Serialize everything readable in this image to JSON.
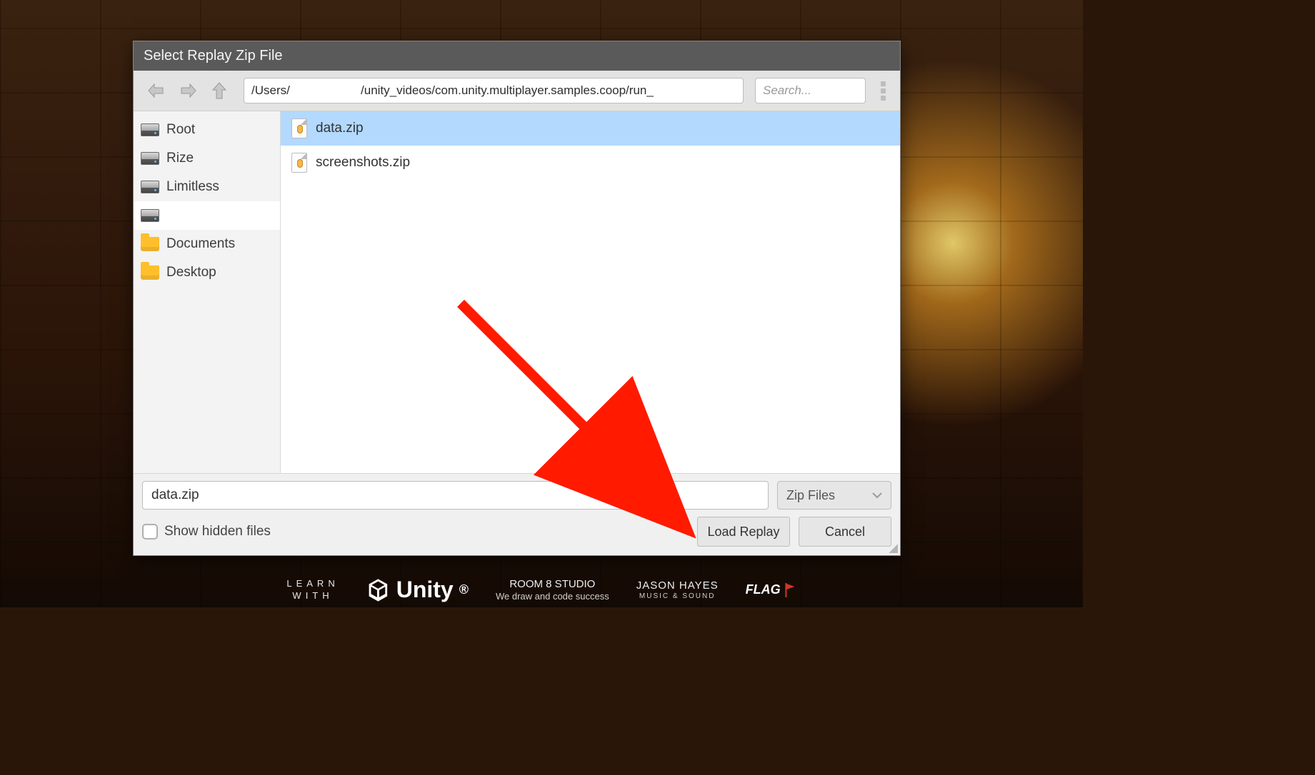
{
  "dialog": {
    "title": "Select Replay Zip File",
    "path_value": "/Users/                     /unity_videos/com.unity.multiplayer.samples.coop/run_",
    "search_placeholder": "Search...",
    "sidebar": [
      {
        "icon": "drive",
        "label": "Root",
        "selected": false
      },
      {
        "icon": "drive",
        "label": "Rize",
        "selected": false
      },
      {
        "icon": "drive",
        "label": "Limitless",
        "selected": false
      },
      {
        "icon": "drive",
        "label": "",
        "selected": true
      },
      {
        "icon": "folder",
        "label": "Documents",
        "selected": false
      },
      {
        "icon": "folder",
        "label": "Desktop",
        "selected": false
      }
    ],
    "files": [
      {
        "name": "data.zip",
        "selected": true
      },
      {
        "name": "screenshots.zip",
        "selected": false
      }
    ],
    "filename_value": "data.zip",
    "type_label": "Zip Files",
    "show_hidden_label": "Show hidden files",
    "show_hidden_checked": false,
    "load_button": "Load Replay",
    "cancel_button": "Cancel"
  },
  "game_footer": {
    "learn_top": "LEARN",
    "learn_bottom": "WITH",
    "unity": "Unity",
    "room8_top": "ROOM 8 STUDIO",
    "room8_bottom": "We draw and code success",
    "jason_top": "JASON HAYES",
    "jason_bottom": "MUSIC & SOUND",
    "flag": "FLAG"
  }
}
